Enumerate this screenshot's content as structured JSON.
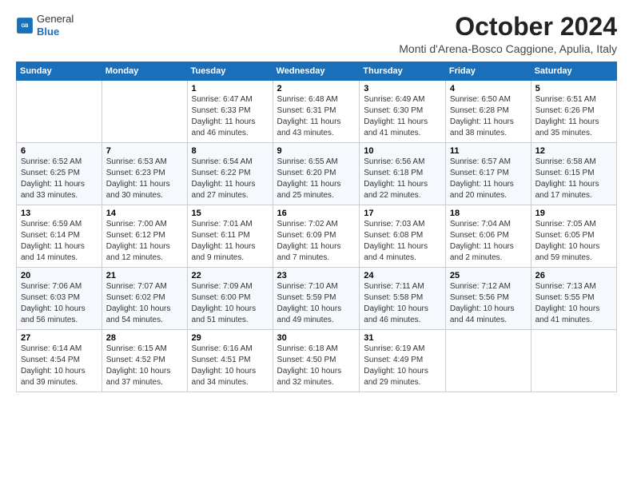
{
  "app": {
    "name": "GeneralBlue",
    "logo_text_line1": "General",
    "logo_text_line2": "Blue"
  },
  "header": {
    "month_title": "October 2024",
    "location": "Monti d'Arena-Bosco Caggione, Apulia, Italy"
  },
  "weekdays": [
    "Sunday",
    "Monday",
    "Tuesday",
    "Wednesday",
    "Thursday",
    "Friday",
    "Saturday"
  ],
  "weeks": [
    [
      {
        "day": "",
        "info": ""
      },
      {
        "day": "",
        "info": ""
      },
      {
        "day": "1",
        "info": "Sunrise: 6:47 AM\nSunset: 6:33 PM\nDaylight: 11 hours and 46 minutes."
      },
      {
        "day": "2",
        "info": "Sunrise: 6:48 AM\nSunset: 6:31 PM\nDaylight: 11 hours and 43 minutes."
      },
      {
        "day": "3",
        "info": "Sunrise: 6:49 AM\nSunset: 6:30 PM\nDaylight: 11 hours and 41 minutes."
      },
      {
        "day": "4",
        "info": "Sunrise: 6:50 AM\nSunset: 6:28 PM\nDaylight: 11 hours and 38 minutes."
      },
      {
        "day": "5",
        "info": "Sunrise: 6:51 AM\nSunset: 6:26 PM\nDaylight: 11 hours and 35 minutes."
      }
    ],
    [
      {
        "day": "6",
        "info": "Sunrise: 6:52 AM\nSunset: 6:25 PM\nDaylight: 11 hours and 33 minutes."
      },
      {
        "day": "7",
        "info": "Sunrise: 6:53 AM\nSunset: 6:23 PM\nDaylight: 11 hours and 30 minutes."
      },
      {
        "day": "8",
        "info": "Sunrise: 6:54 AM\nSunset: 6:22 PM\nDaylight: 11 hours and 27 minutes."
      },
      {
        "day": "9",
        "info": "Sunrise: 6:55 AM\nSunset: 6:20 PM\nDaylight: 11 hours and 25 minutes."
      },
      {
        "day": "10",
        "info": "Sunrise: 6:56 AM\nSunset: 6:18 PM\nDaylight: 11 hours and 22 minutes."
      },
      {
        "day": "11",
        "info": "Sunrise: 6:57 AM\nSunset: 6:17 PM\nDaylight: 11 hours and 20 minutes."
      },
      {
        "day": "12",
        "info": "Sunrise: 6:58 AM\nSunset: 6:15 PM\nDaylight: 11 hours and 17 minutes."
      }
    ],
    [
      {
        "day": "13",
        "info": "Sunrise: 6:59 AM\nSunset: 6:14 PM\nDaylight: 11 hours and 14 minutes."
      },
      {
        "day": "14",
        "info": "Sunrise: 7:00 AM\nSunset: 6:12 PM\nDaylight: 11 hours and 12 minutes."
      },
      {
        "day": "15",
        "info": "Sunrise: 7:01 AM\nSunset: 6:11 PM\nDaylight: 11 hours and 9 minutes."
      },
      {
        "day": "16",
        "info": "Sunrise: 7:02 AM\nSunset: 6:09 PM\nDaylight: 11 hours and 7 minutes."
      },
      {
        "day": "17",
        "info": "Sunrise: 7:03 AM\nSunset: 6:08 PM\nDaylight: 11 hours and 4 minutes."
      },
      {
        "day": "18",
        "info": "Sunrise: 7:04 AM\nSunset: 6:06 PM\nDaylight: 11 hours and 2 minutes."
      },
      {
        "day": "19",
        "info": "Sunrise: 7:05 AM\nSunset: 6:05 PM\nDaylight: 10 hours and 59 minutes."
      }
    ],
    [
      {
        "day": "20",
        "info": "Sunrise: 7:06 AM\nSunset: 6:03 PM\nDaylight: 10 hours and 56 minutes."
      },
      {
        "day": "21",
        "info": "Sunrise: 7:07 AM\nSunset: 6:02 PM\nDaylight: 10 hours and 54 minutes."
      },
      {
        "day": "22",
        "info": "Sunrise: 7:09 AM\nSunset: 6:00 PM\nDaylight: 10 hours and 51 minutes."
      },
      {
        "day": "23",
        "info": "Sunrise: 7:10 AM\nSunset: 5:59 PM\nDaylight: 10 hours and 49 minutes."
      },
      {
        "day": "24",
        "info": "Sunrise: 7:11 AM\nSunset: 5:58 PM\nDaylight: 10 hours and 46 minutes."
      },
      {
        "day": "25",
        "info": "Sunrise: 7:12 AM\nSunset: 5:56 PM\nDaylight: 10 hours and 44 minutes."
      },
      {
        "day": "26",
        "info": "Sunrise: 7:13 AM\nSunset: 5:55 PM\nDaylight: 10 hours and 41 minutes."
      }
    ],
    [
      {
        "day": "27",
        "info": "Sunrise: 6:14 AM\nSunset: 4:54 PM\nDaylight: 10 hours and 39 minutes."
      },
      {
        "day": "28",
        "info": "Sunrise: 6:15 AM\nSunset: 4:52 PM\nDaylight: 10 hours and 37 minutes."
      },
      {
        "day": "29",
        "info": "Sunrise: 6:16 AM\nSunset: 4:51 PM\nDaylight: 10 hours and 34 minutes."
      },
      {
        "day": "30",
        "info": "Sunrise: 6:18 AM\nSunset: 4:50 PM\nDaylight: 10 hours and 32 minutes."
      },
      {
        "day": "31",
        "info": "Sunrise: 6:19 AM\nSunset: 4:49 PM\nDaylight: 10 hours and 29 minutes."
      },
      {
        "day": "",
        "info": ""
      },
      {
        "day": "",
        "info": ""
      }
    ]
  ]
}
